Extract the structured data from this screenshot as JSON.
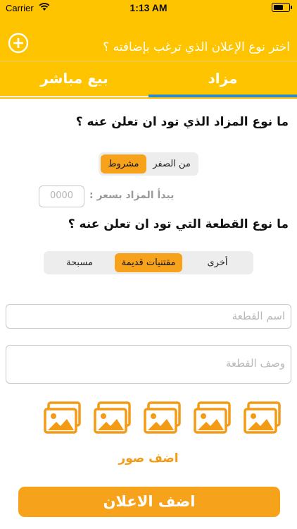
{
  "status_bar": {
    "carrier": "Carrier",
    "time": "1:13 AM"
  },
  "header": {
    "title": "اختر نوع الإعلان الذي ترغب بإضافته ؟",
    "tabs": [
      {
        "label": "مزاد",
        "active": true
      },
      {
        "label": "بيع مباشر",
        "active": false
      }
    ]
  },
  "auction_type": {
    "question": "ما نوع المزاد الذي تود ان تعلن عنه ؟",
    "options": [
      {
        "label": "من الصفر",
        "active": false
      },
      {
        "label": "مشروط",
        "active": true
      }
    ],
    "start_price_label": "يبدأ المزاد بسعر :",
    "start_price_placeholder": "0000"
  },
  "item_type": {
    "question": "ما نوع القطعة التي تود ان تعلن عنه ؟",
    "options": [
      {
        "label": "أخرى",
        "active": false
      },
      {
        "label": "مقتنيات قديمة",
        "active": true
      },
      {
        "label": "مسبحة",
        "active": false
      }
    ]
  },
  "form": {
    "name_placeholder": "اسم القطعة",
    "description_placeholder": "وصف القطعة"
  },
  "photos": {
    "slots": 5,
    "add_label": "اضف صور"
  },
  "submit_label": "اضف الاعلان",
  "colors": {
    "header": "#ffc400",
    "accent": "#f7a21b",
    "tab_indicator": "#2e89c9"
  }
}
